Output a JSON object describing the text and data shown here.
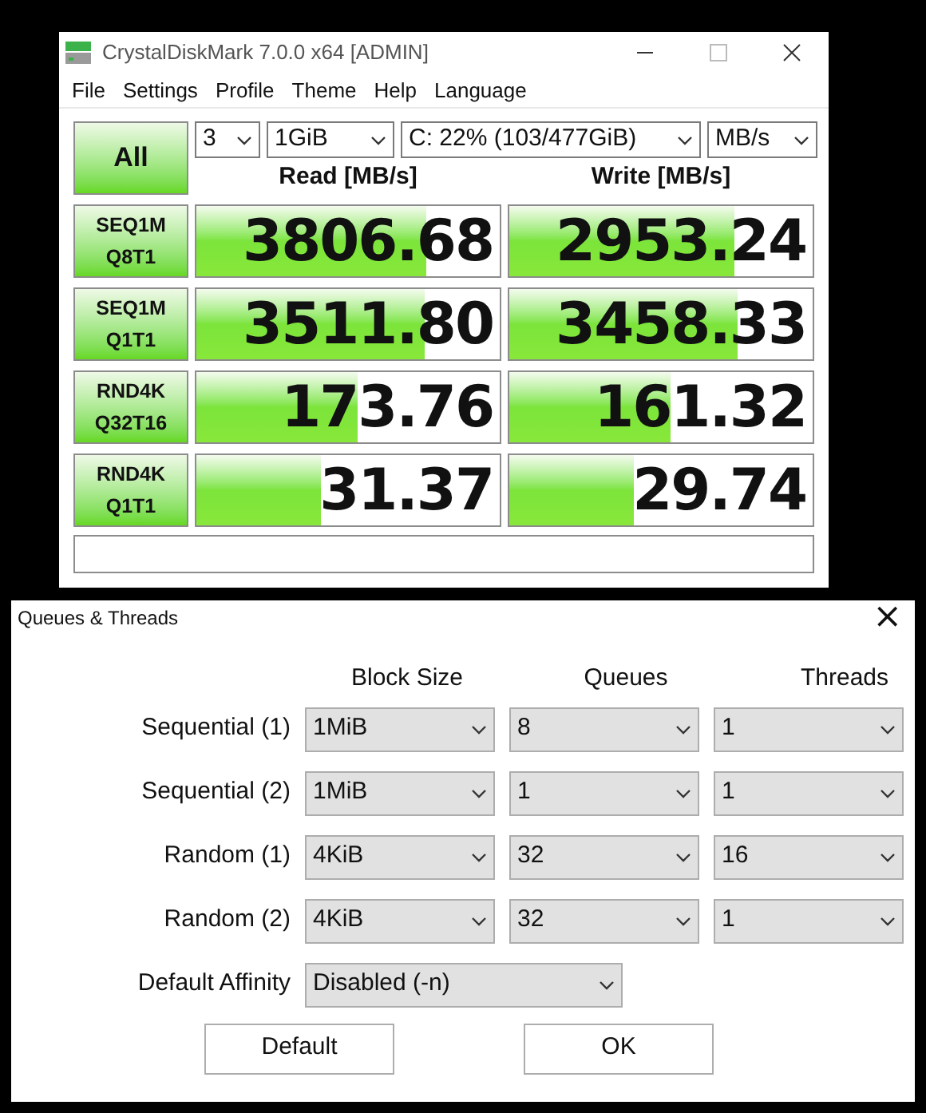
{
  "main_window": {
    "title": "CrystalDiskMark 7.0.0 x64 [ADMIN]",
    "menu": [
      "File",
      "Settings",
      "Profile",
      "Theme",
      "Help",
      "Language"
    ],
    "all_button": "All",
    "count_select": "3",
    "size_select": "1GiB",
    "drive_select": "C: 22% (103/477GiB)",
    "unit_select": "MB/s",
    "columns": [
      "Read [MB/s]",
      "Write [MB/s]"
    ],
    "tests": [
      {
        "line1": "SEQ1M",
        "line2": "Q8T1",
        "read": {
          "value": "3806.68",
          "level": 0.76
        },
        "write": {
          "value": "2953.24",
          "level": 0.74
        }
      },
      {
        "line1": "SEQ1M",
        "line2": "Q1T1",
        "read": {
          "value": "3511.80",
          "level": 0.75
        },
        "write": {
          "value": "3458.33",
          "level": 0.75
        }
      },
      {
        "line1": "RND4K",
        "line2": "Q32T16",
        "read": {
          "value": "173.76",
          "level": 0.53
        },
        "write": {
          "value": "161.32",
          "level": 0.53
        }
      },
      {
        "line1": "RND4K",
        "line2": "Q1T1",
        "read": {
          "value": "31.37",
          "level": 0.41
        },
        "write": {
          "value": "29.74",
          "level": 0.41
        }
      }
    ]
  },
  "dialog": {
    "title": "Queues & Threads",
    "close": "×",
    "columns": [
      "Block Size",
      "Queues",
      "Threads"
    ],
    "rows": [
      {
        "label": "Sequential (1)",
        "block_size": "1MiB",
        "queues": "8",
        "threads": "1"
      },
      {
        "label": "Sequential (2)",
        "block_size": "1MiB",
        "queues": "1",
        "threads": "1"
      },
      {
        "label": "Random (1)",
        "block_size": "4KiB",
        "queues": "32",
        "threads": "16"
      },
      {
        "label": "Random (2)",
        "block_size": "4KiB",
        "queues": "32",
        "threads": "1"
      }
    ],
    "affinity": {
      "label": "Default Affinity",
      "value": "Disabled (-n)"
    },
    "buttons": [
      "Default",
      "OK"
    ]
  }
}
